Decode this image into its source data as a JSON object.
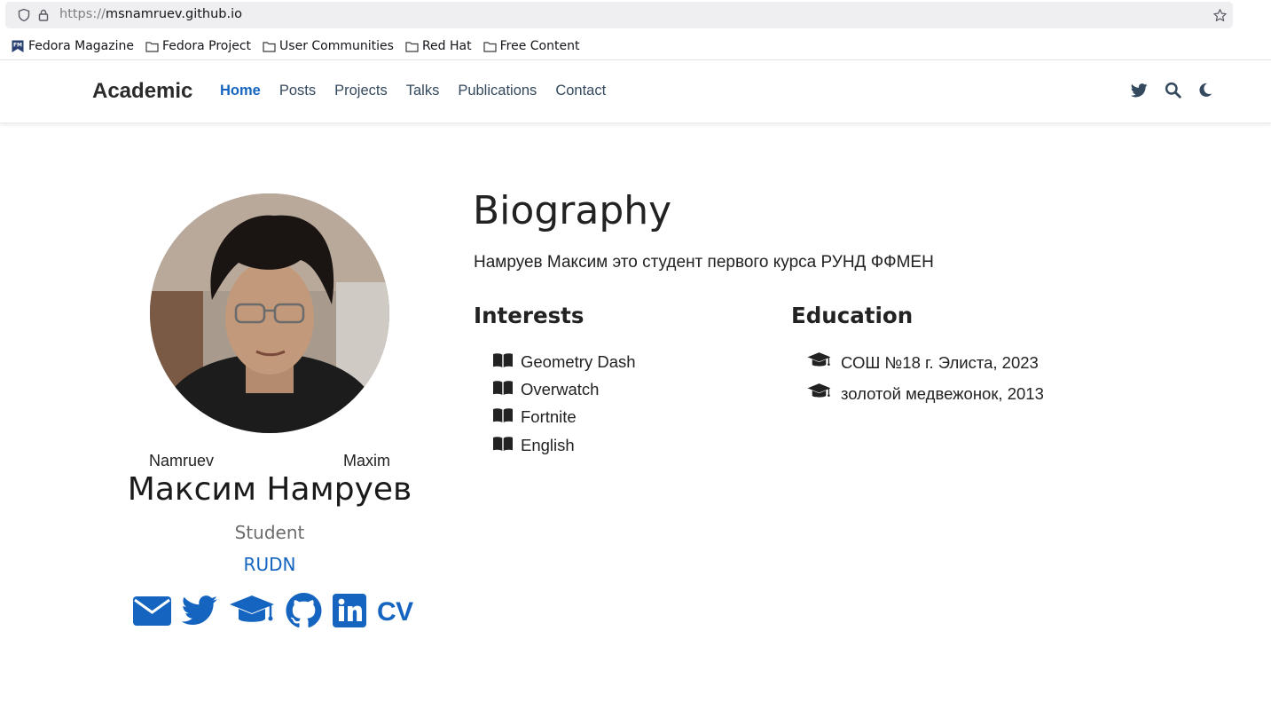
{
  "browser": {
    "url_scheme": "https://",
    "url_host": "msnamruev.github.io",
    "bookmarks": [
      {
        "label": "Fedora Magazine",
        "icon": "fedora-magazine-favicon"
      },
      {
        "label": "Fedora Project",
        "icon": "folder-icon"
      },
      {
        "label": "User Communities",
        "icon": "folder-icon"
      },
      {
        "label": "Red Hat",
        "icon": "folder-icon"
      },
      {
        "label": "Free Content",
        "icon": "folder-icon"
      }
    ]
  },
  "nav": {
    "brand": "Academic",
    "links": [
      {
        "label": "Home",
        "active": true
      },
      {
        "label": "Posts"
      },
      {
        "label": "Projects"
      },
      {
        "label": "Talks"
      },
      {
        "label": "Publications"
      },
      {
        "label": "Contact"
      }
    ],
    "icons": [
      "twitter-icon",
      "search-icon",
      "moon-icon"
    ]
  },
  "profile": {
    "last_name": "Namruev",
    "first_name": "Maxim",
    "full_name": "Максим Намруев",
    "role": "Student",
    "organization": "RUDN",
    "social_icons": [
      "envelope-icon",
      "twitter-icon",
      "graduation-cap-icon",
      "github-icon",
      "linkedin-icon"
    ],
    "cv_label": "CV"
  },
  "bio": {
    "title": "Biography",
    "text": "Намруев Максим это студент первого курса РУНД ФФМЕН",
    "interests_title": "Interests",
    "interests": [
      "Geometry Dash",
      "Overwatch",
      "Fortnite",
      "English"
    ],
    "education_title": "Education",
    "education": [
      "СОШ №18 г. Элиста, 2023",
      "золотой медвежонок, 2013"
    ]
  },
  "colors": {
    "accent": "#1565c0",
    "text": "#222222",
    "muted": "#6c6c6c"
  }
}
